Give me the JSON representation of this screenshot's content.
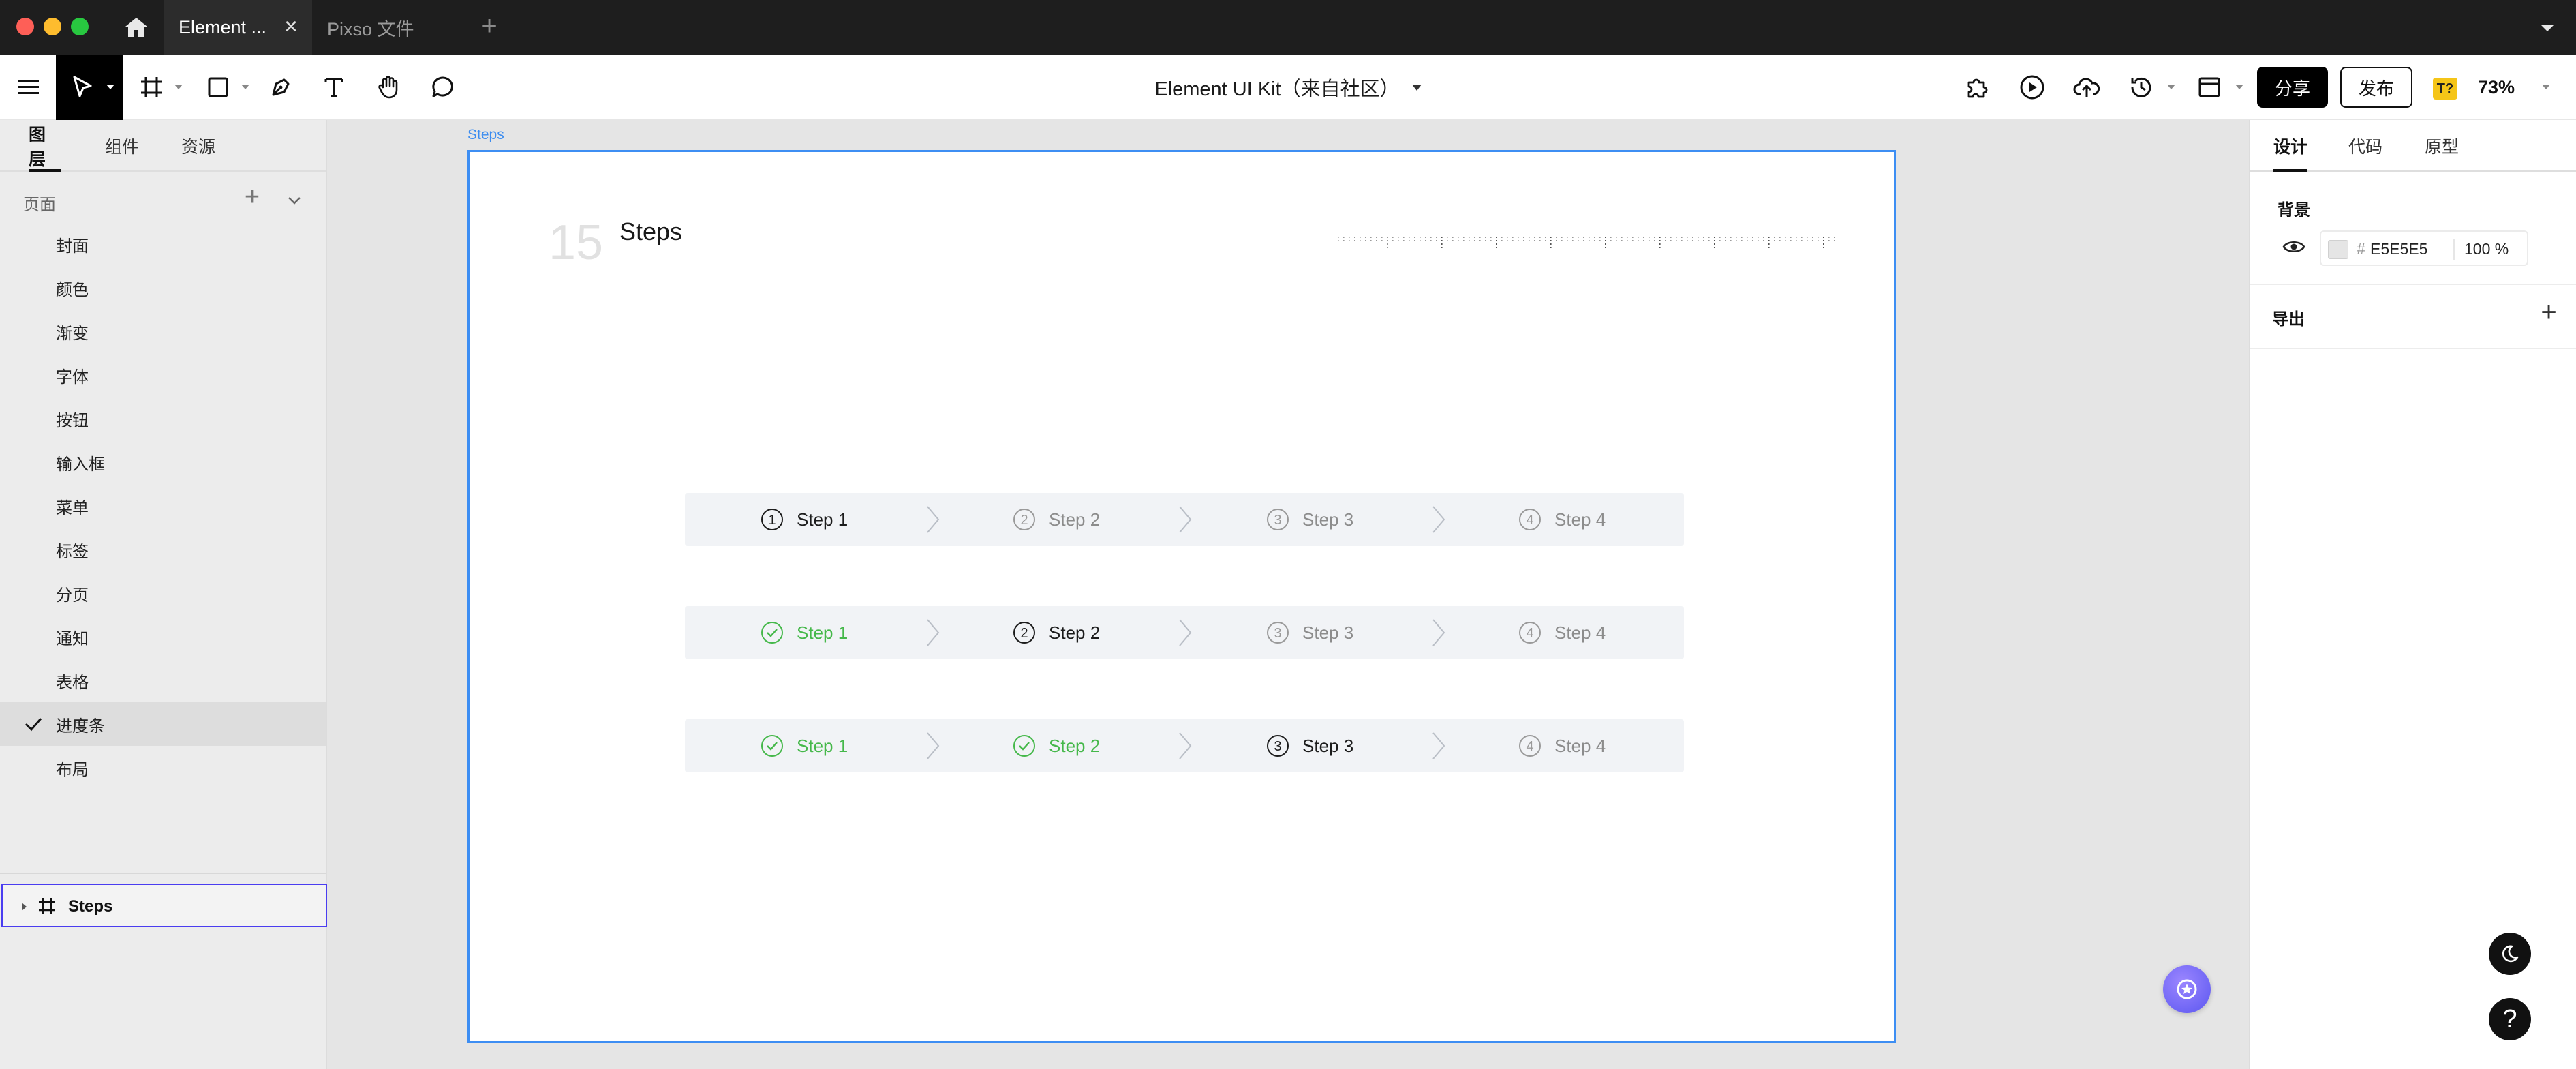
{
  "titlebar": {
    "tabs": [
      {
        "label": "Element ..."
      },
      {
        "label": "Pixso 文件"
      }
    ],
    "close_glyph": "✕",
    "add_glyph": "+"
  },
  "toolbar": {
    "document_title": "Element UI Kit（来自社区）",
    "share_label": "分享",
    "publish_label": "发布",
    "font_badge": "T?",
    "zoom": "73%"
  },
  "left_panel": {
    "tabs": [
      "图层",
      "组件",
      "资源"
    ],
    "pages_header": "页面",
    "pages_add_glyph": "+",
    "pages": [
      {
        "label": "封面"
      },
      {
        "label": "颜色"
      },
      {
        "label": "渐变"
      },
      {
        "label": "字体"
      },
      {
        "label": "按钮"
      },
      {
        "label": "输入框"
      },
      {
        "label": "菜单"
      },
      {
        "label": "标签"
      },
      {
        "label": "分页"
      },
      {
        "label": "通知"
      },
      {
        "label": "表格"
      },
      {
        "label": "进度条",
        "selected": true
      },
      {
        "label": "布局"
      }
    ],
    "layer": {
      "name": "Steps"
    }
  },
  "canvas": {
    "background": "#E5E5E5",
    "frame_label": "Steps",
    "frame_number": "15",
    "frame_heading": "Steps",
    "step_rows": [
      {
        "steps": [
          {
            "label": "Step 1",
            "number": "1",
            "state": "current"
          },
          {
            "label": "Step 2",
            "number": "2",
            "state": "wait"
          },
          {
            "label": "Step 3",
            "number": "3",
            "state": "wait"
          },
          {
            "label": "Step 4",
            "number": "4",
            "state": "wait"
          }
        ]
      },
      {
        "steps": [
          {
            "label": "Step 1",
            "number": "1",
            "state": "done"
          },
          {
            "label": "Step 2",
            "number": "2",
            "state": "current"
          },
          {
            "label": "Step 3",
            "number": "3",
            "state": "wait"
          },
          {
            "label": "Step 4",
            "number": "4",
            "state": "wait"
          }
        ]
      },
      {
        "steps": [
          {
            "label": "Step 1",
            "number": "1",
            "state": "done"
          },
          {
            "label": "Step 2",
            "number": "2",
            "state": "done"
          },
          {
            "label": "Step 3",
            "number": "3",
            "state": "current"
          },
          {
            "label": "Step 4",
            "number": "4",
            "state": "wait"
          }
        ]
      }
    ]
  },
  "right_panel": {
    "tabs": [
      "设计",
      "代码",
      "原型"
    ],
    "background_section": "背景",
    "background_hash": "#",
    "background_hex": "E5E5E5",
    "background_opacity": "100 %",
    "export_section": "导出",
    "export_add_glyph": "+",
    "help_glyph": "?"
  },
  "colors": {
    "accent": "#3D8EF3",
    "success": "#45B84A",
    "layer_selection": "#4A3DF0"
  }
}
